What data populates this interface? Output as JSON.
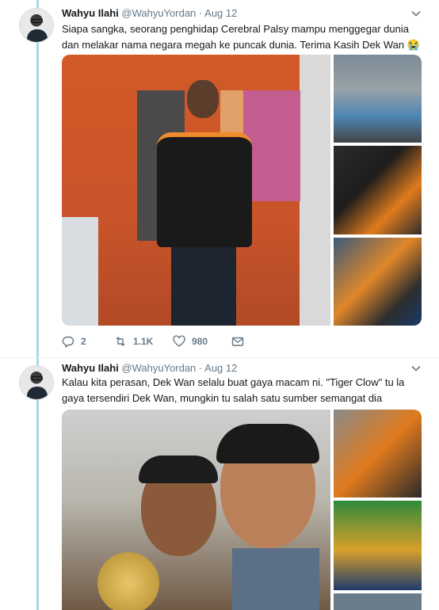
{
  "tweets": [
    {
      "name": "Wahyu Ilahi",
      "handle": "@WahyuYordan",
      "separator": "·",
      "date": "Aug 12",
      "text": "Siapa sangka, seorang penghidap Cerebral Palsy mampu menggegar dunia dan melakar nama negara megah ke puncak dunia. Terima Kasih Dek Wan 😭😚",
      "replies": "2",
      "retweets": "1.1K",
      "likes": "980"
    },
    {
      "name": "Wahyu Ilahi",
      "handle": "@WahyuYordan",
      "separator": "·",
      "date": "Aug 12",
      "text": "Kalau kita perasan, Dek Wan selalu buat gaya macam ni. \"Tiger Clow\" tu la gaya tersendiri Dek Wan, mungkin tu salah satu sumber semangat dia"
    }
  ],
  "icons": {
    "reply": "reply-icon",
    "retweet": "retweet-icon",
    "like": "heart-icon",
    "message": "envelope-icon",
    "caret": "chevron-down-icon"
  },
  "colors": {
    "thread_line": "#a8d8e8",
    "secondary_text": "#657786",
    "primary_text": "#14171a"
  }
}
